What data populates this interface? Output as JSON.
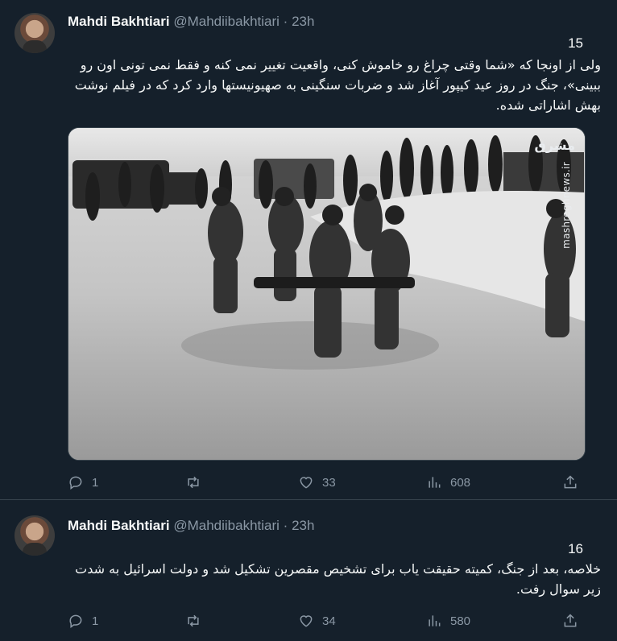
{
  "watermark": {
    "logo": "مشرق",
    "url": "mashreghnews.ir"
  },
  "tweets": [
    {
      "author_name": "Mahdi Bakhtiari",
      "handle": "@Mahdiibakhtiari",
      "separator": "·",
      "time": "23h",
      "thread_number": "15",
      "text": "ولی از اونجا که «شما وقتی چراغ رو خاموش کنی، واقعیت تغییر نمی کنه و فقط نمی تونی اون رو ببینی»، جنگ در روز عید کیپور آغاز شد و ضربات سنگینی به صهیونیستها وارد کرد که در فیلم نوشت بهش اشاراتی شده.",
      "stats": {
        "replies": "1",
        "retweets": "",
        "likes": "33",
        "views": "608"
      }
    },
    {
      "author_name": "Mahdi Bakhtiari",
      "handle": "@Mahdiibakhtiari",
      "separator": "·",
      "time": "23h",
      "thread_number": "16",
      "text": "خلاصه، بعد از جنگ، کمیته حقیقت یاب برای تشخیص مقصرین تشکیل شد و دولت اسرائیل به شدت زیر سوال رفت.",
      "stats": {
        "replies": "1",
        "retweets": "",
        "likes": "34",
        "views": "580"
      }
    }
  ]
}
